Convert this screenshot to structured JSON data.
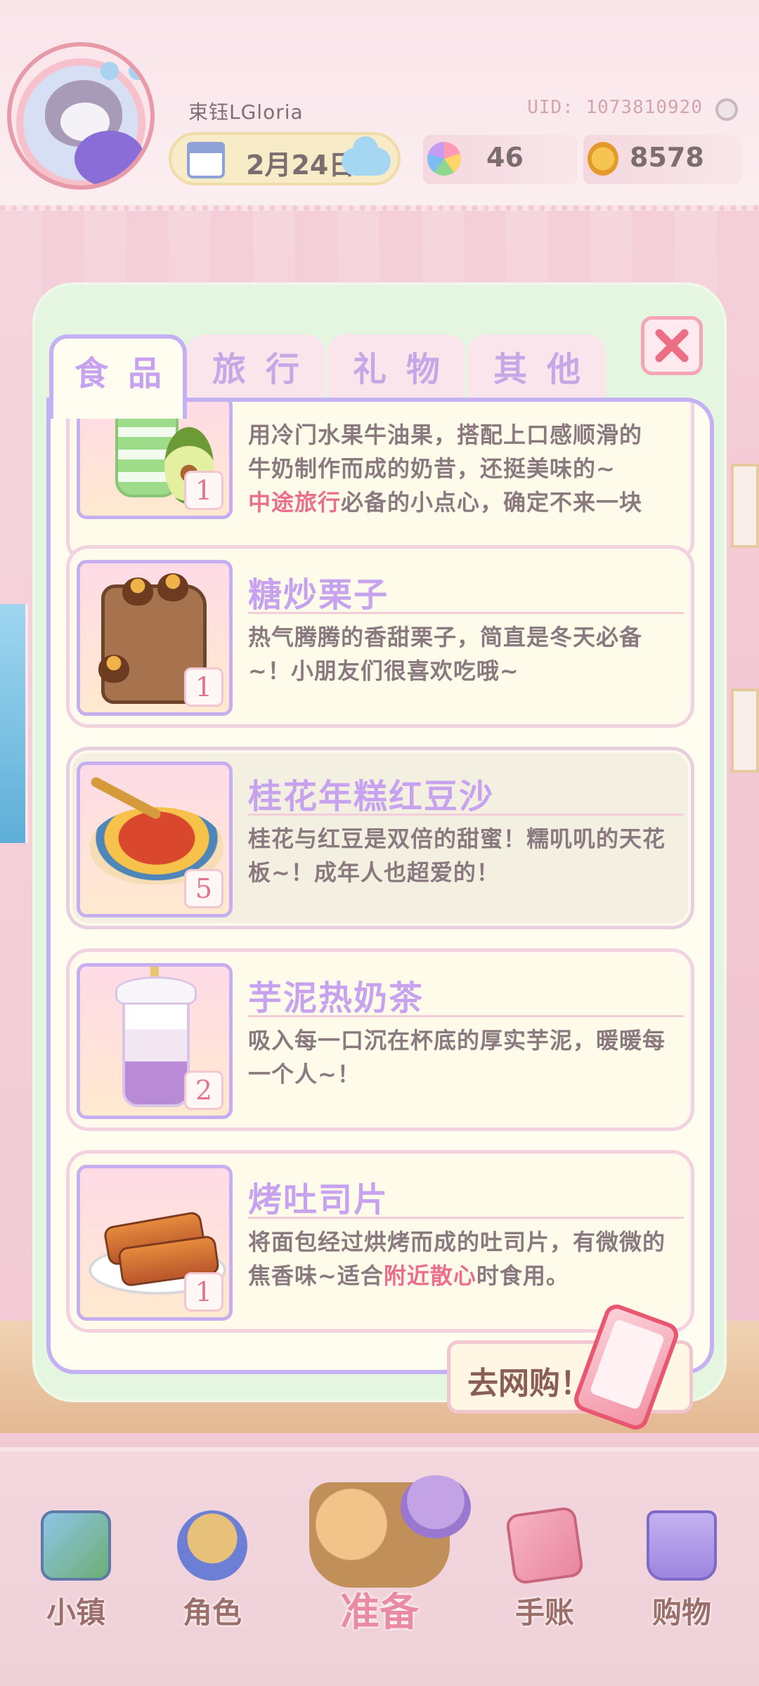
{
  "header": {
    "player_name": "束钰LGloria",
    "uid": "UID: 1073810920",
    "date": "2月24日",
    "gems": "46",
    "coins": "8578"
  },
  "tabs": [
    {
      "label": "食品",
      "active": true
    },
    {
      "label": "旅行",
      "active": false
    },
    {
      "label": "礼物",
      "active": false
    },
    {
      "label": "其他",
      "active": false
    }
  ],
  "items": [
    {
      "title": "",
      "desc_line1": "用冷门水果牛油果，搭配上口感顺滑的",
      "desc_line2": "牛奶制作而成的奶昔，还挺美味的~",
      "desc_hl": "中途旅行",
      "desc_rest": "必备的小点心，确定不来一块",
      "qty": "1"
    },
    {
      "title": "糖炒栗子",
      "desc": "热气腾腾的香甜栗子，简直是冬天必备~！小朋友们很喜欢吃哦~",
      "qty": "1"
    },
    {
      "title": "桂花年糕红豆沙",
      "desc": "桂花与红豆是双倍的甜蜜！糯叽叽的天花板~！成年人也超爱的！",
      "qty": "5",
      "selected": true
    },
    {
      "title": "芋泥热奶茶",
      "desc": "吸入每一口沉在杯底的厚实芋泥，暖暖每一个人~！",
      "qty": "2"
    },
    {
      "title": "烤吐司片",
      "desc_pre": "将面包经过烘烤而成的吐司片，有微微的焦香味~适合",
      "desc_hl": "附近散心",
      "desc_post": "时食用。",
      "qty": "1"
    }
  ],
  "shop_button": {
    "label": "去网购！"
  },
  "nav": [
    {
      "label": "小镇",
      "icon": "map-icon"
    },
    {
      "label": "角色",
      "icon": "character-icon"
    },
    {
      "label": "准备",
      "icon": "basket-icon",
      "active": true
    },
    {
      "label": "手账",
      "icon": "diary-icon"
    },
    {
      "label": "购物",
      "icon": "shopping-bag-icon"
    }
  ],
  "colors": {
    "accent_purple": "#c7a2ee",
    "highlight_pink": "#ea6f8e",
    "panel_border": "#c3b1f4",
    "modal_bg": "#e4f6df"
  }
}
